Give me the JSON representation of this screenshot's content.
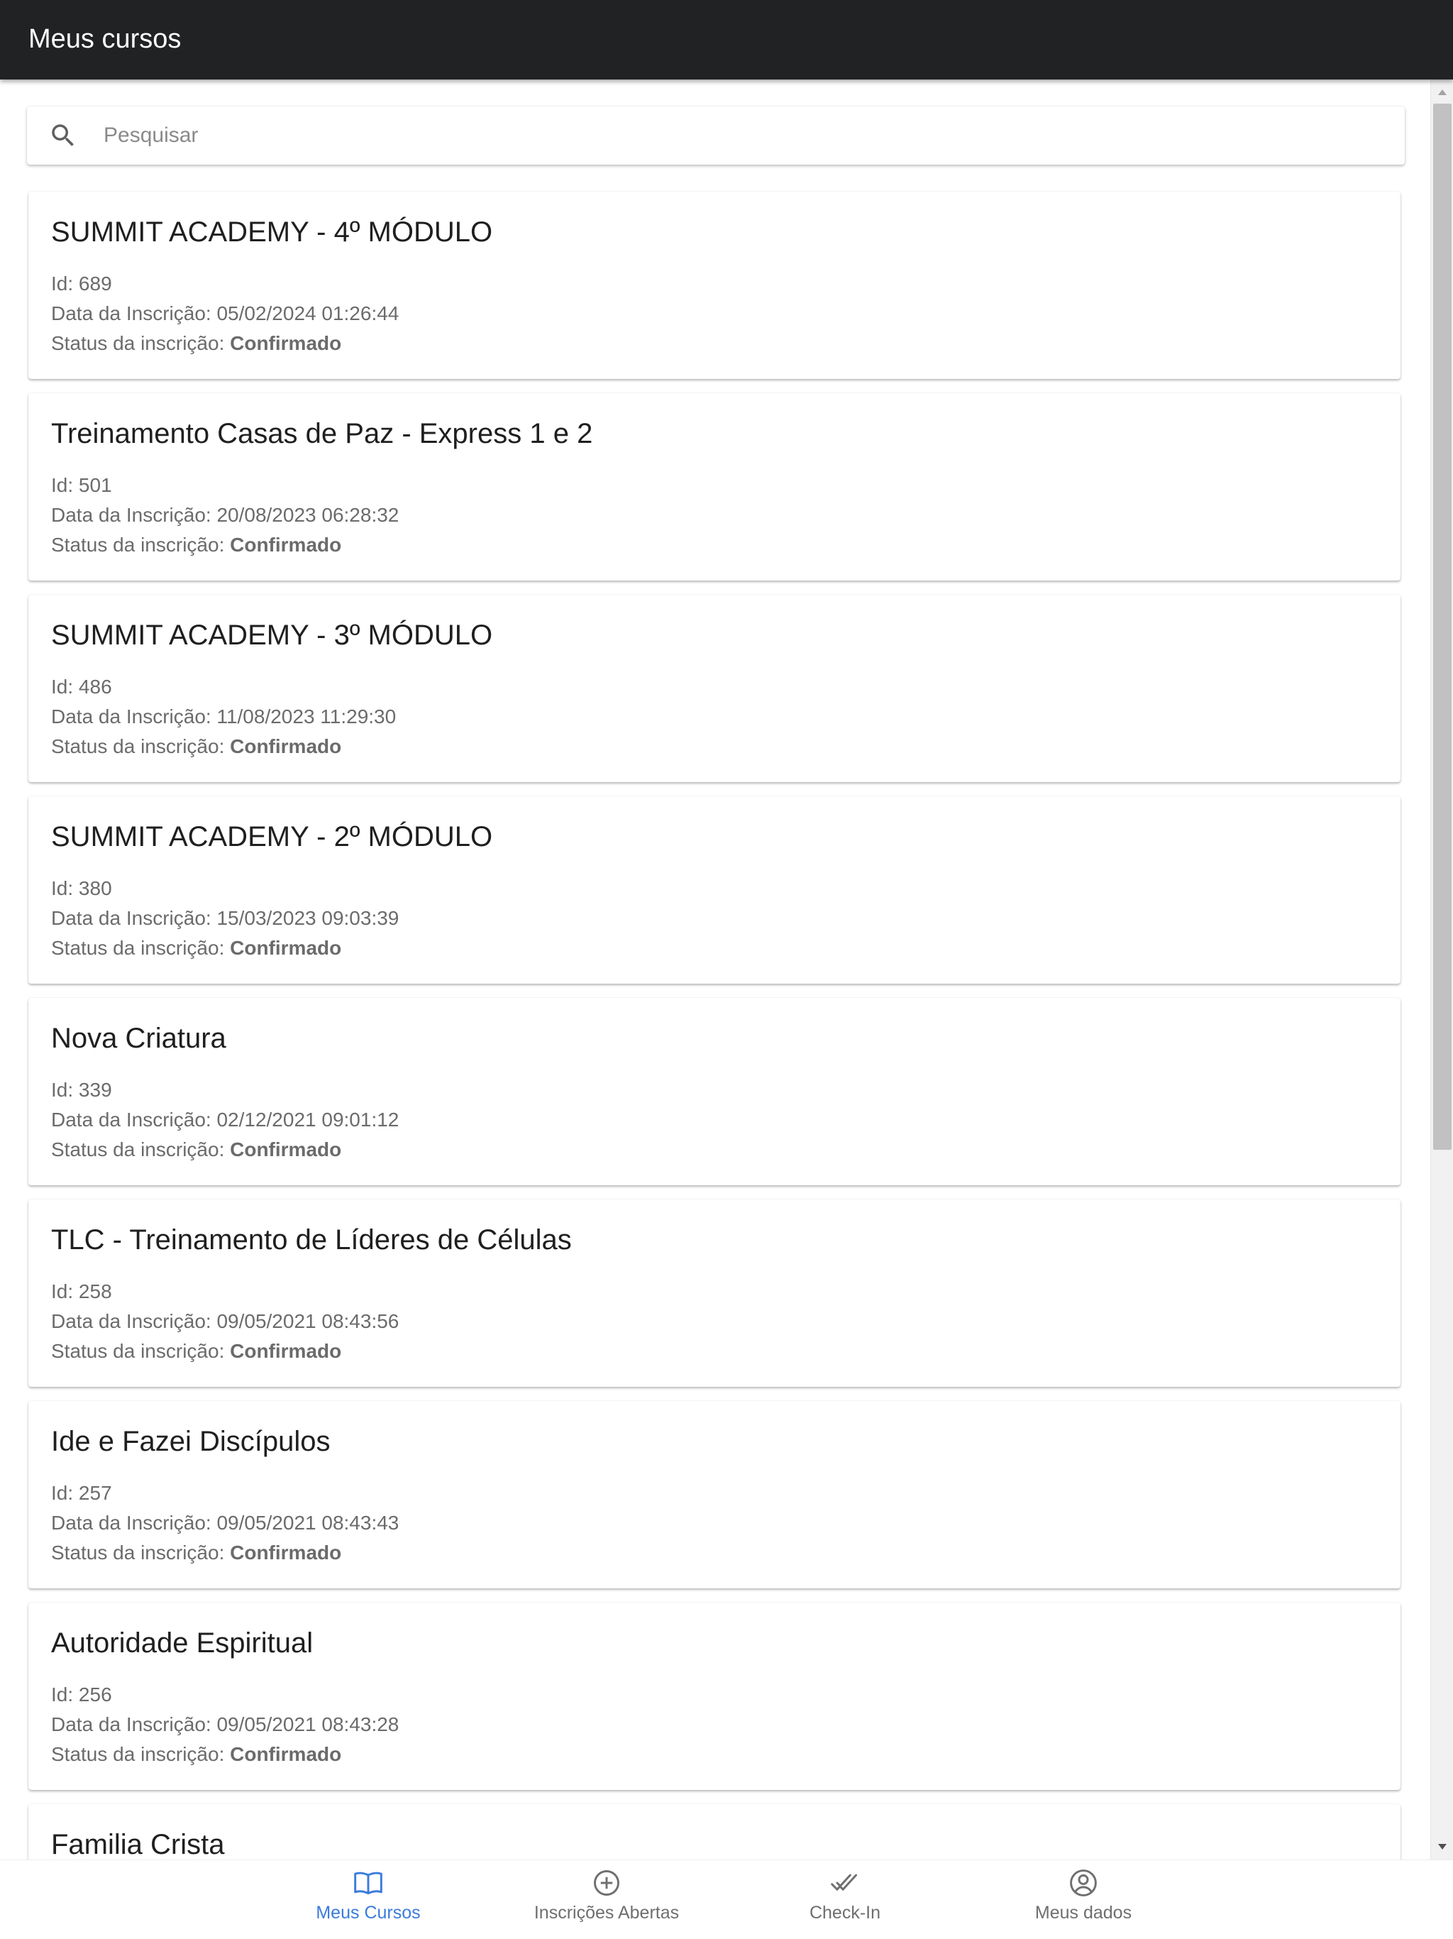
{
  "app_bar": {
    "title": "Meus cursos"
  },
  "search": {
    "placeholder": "Pesquisar",
    "value": ""
  },
  "labels": {
    "id_prefix": "Id: ",
    "date_prefix": "Data da Inscrição: ",
    "status_prefix": "Status da inscrição: "
  },
  "courses": [
    {
      "title": "SUMMIT ACADEMY - 4º MÓDULO",
      "id": "689",
      "date": "05/02/2024 01:26:44",
      "status": "Confirmado"
    },
    {
      "title": "Treinamento Casas de Paz - Express 1 e 2",
      "id": "501",
      "date": "20/08/2023 06:28:32",
      "status": "Confirmado"
    },
    {
      "title": "SUMMIT ACADEMY - 3º MÓDULO",
      "id": "486",
      "date": "11/08/2023 11:29:30",
      "status": "Confirmado"
    },
    {
      "title": "SUMMIT ACADEMY - 2º MÓDULO",
      "id": "380",
      "date": "15/03/2023 09:03:39",
      "status": "Confirmado"
    },
    {
      "title": "Nova Criatura",
      "id": "339",
      "date": "02/12/2021 09:01:12",
      "status": "Confirmado"
    },
    {
      "title": "TLC - Treinamento de Líderes de Células",
      "id": "258",
      "date": "09/05/2021 08:43:56",
      "status": "Confirmado"
    },
    {
      "title": "Ide e Fazei Discípulos",
      "id": "257",
      "date": "09/05/2021 08:43:43",
      "status": "Confirmado"
    },
    {
      "title": "Autoridade Espiritual",
      "id": "256",
      "date": "09/05/2021 08:43:28",
      "status": "Confirmado"
    },
    {
      "title": "Familia Crista",
      "id": "",
      "date": "",
      "status": ""
    }
  ],
  "bottom_nav": {
    "items": [
      {
        "label": "Meus Cursos",
        "icon": "book-open-icon",
        "active": true
      },
      {
        "label": "Inscrições Abertas",
        "icon": "add-circle-icon",
        "active": false
      },
      {
        "label": "Check-In",
        "icon": "double-check-icon",
        "active": false
      },
      {
        "label": "Meus dados",
        "icon": "account-circle-icon",
        "active": false
      }
    ]
  },
  "colors": {
    "app_bar_bg": "#212224",
    "accent_active": "#3b7bdc",
    "inactive": "#6f6f6f"
  }
}
